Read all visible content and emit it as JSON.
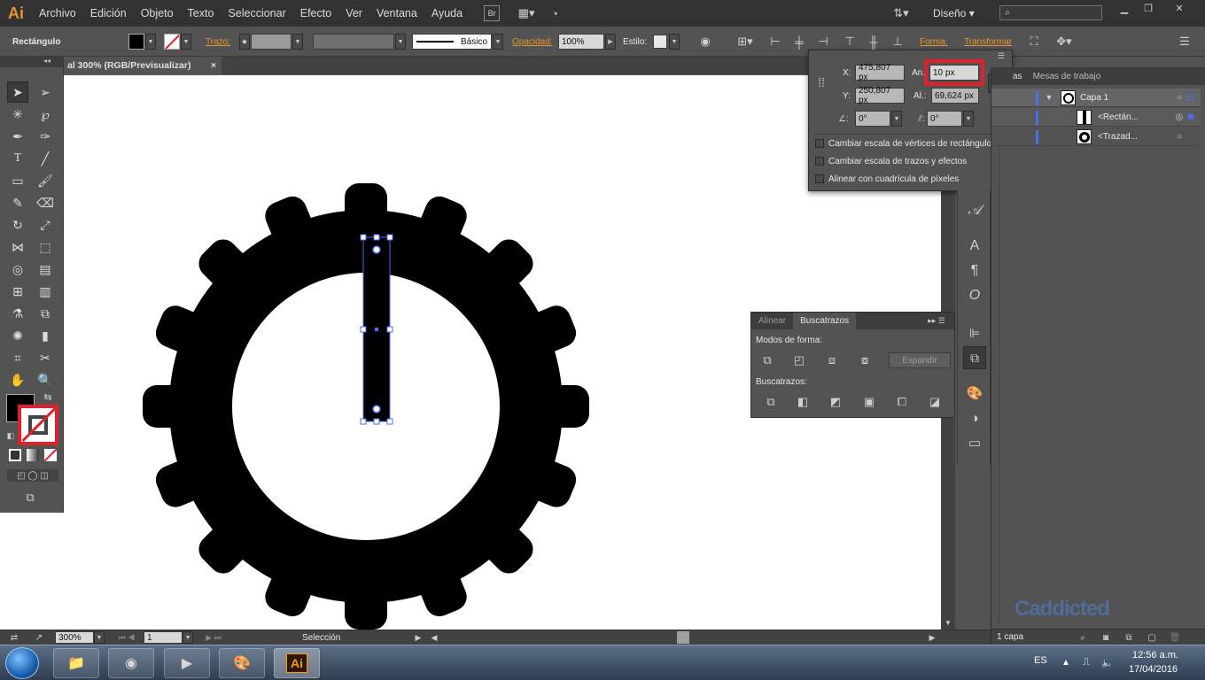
{
  "app": {
    "logo": "Ai",
    "workspace": "Diseño"
  },
  "menu": [
    "Archivo",
    "Edición",
    "Objeto",
    "Texto",
    "Seleccionar",
    "Efecto",
    "Ver",
    "Ventana",
    "Ayuda"
  ],
  "menubar_extra": {
    "bridge": "Br"
  },
  "control": {
    "object_type": "Rectángulo",
    "stroke_label": "Trazo:",
    "brush_label": "Básico",
    "opacity_label": "Opacidad:",
    "opacity_value": "100%",
    "style_label": "Estilo:",
    "shape_label": "Forma:",
    "transform_label": "Transformar"
  },
  "document": {
    "tab_title": "al 300% (RGB/Previsualizar)",
    "close": "×"
  },
  "transform": {
    "x_label": "X:",
    "x_value": "475,807 px",
    "w_label": "An.:",
    "w_value": "10 px",
    "y_label": "Y:",
    "y_value": "250,807 px",
    "h_label": "Al.:",
    "h_value": "69,624 px",
    "angle_value": "0°",
    "shear_value": "0°",
    "options": [
      "Cambiar escala de vértices de rectángulo",
      "Cambiar escala de trazos y efectos",
      "Alinear con cuadrícula de píxeles"
    ]
  },
  "layers": {
    "tab_layers": "as",
    "tab_artboards": "Mesas de trabajo",
    "rows": [
      "Capa 1",
      "<Rectán...",
      "<Trazad..."
    ],
    "footer": "1 capa"
  },
  "pathfinder": {
    "tab_align": "Alinear",
    "tab_pathfinder": "Buscatrazos",
    "shape_modes": "Modos de forma:",
    "expand": "Expandir",
    "pathfinders": "Buscatrazos:"
  },
  "status": {
    "zoom": "300%",
    "artboard": "1",
    "tool": "Selección"
  },
  "taskbar": {
    "lang": "ES",
    "time": "12:56 a.m.",
    "date": "17/04/2016"
  },
  "watermark": "Caddicted",
  "colors": {
    "accent": "#e8952d",
    "selection": "#4a6cf0",
    "highlight": "#e0202a"
  }
}
